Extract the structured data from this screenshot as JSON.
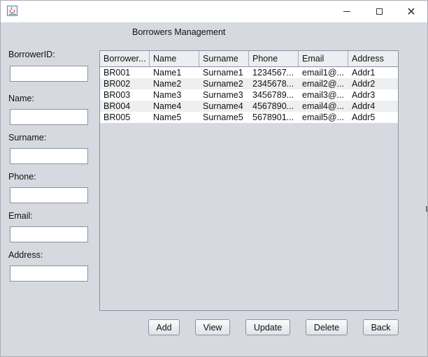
{
  "window": {
    "icons": {
      "app": "java-cup-icon",
      "minimize": "minimize-icon",
      "maximize": "maximize-icon",
      "close": "close-icon"
    },
    "close_glyph": "✕"
  },
  "heading": "Borrowers Management",
  "form": {
    "fields": [
      {
        "label": "BorrowerID:",
        "value": ""
      },
      {
        "label": "Name:",
        "value": ""
      },
      {
        "label": "Surname:",
        "value": ""
      },
      {
        "label": "Phone:",
        "value": ""
      },
      {
        "label": "Email:",
        "value": ""
      },
      {
        "label": "Address:",
        "value": ""
      }
    ]
  },
  "table": {
    "columns": [
      "Borrower...",
      "Name",
      "Surname",
      "Phone",
      "Email",
      "Address"
    ],
    "rows": [
      [
        "BR001",
        "Name1",
        "Surname1",
        "1234567...",
        "email1@...",
        "Addr1"
      ],
      [
        "BR002",
        "Name2",
        "Surname2",
        "2345678...",
        "email2@...",
        "Addr2"
      ],
      [
        "BR003",
        "Name3",
        "Surname3",
        "3456789...",
        "email3@...",
        "Addr3"
      ],
      [
        "BR004",
        "Name4",
        "Surname4",
        "4567890...",
        "email4@...",
        "Addr4"
      ],
      [
        "BR005",
        "Name5",
        "Surname5",
        "5678901...",
        "email5@...",
        "Addr5"
      ]
    ]
  },
  "buttons": {
    "add": "Add",
    "view": "View",
    "update": "Update",
    "delete": "Delete",
    "back": "Back"
  }
}
